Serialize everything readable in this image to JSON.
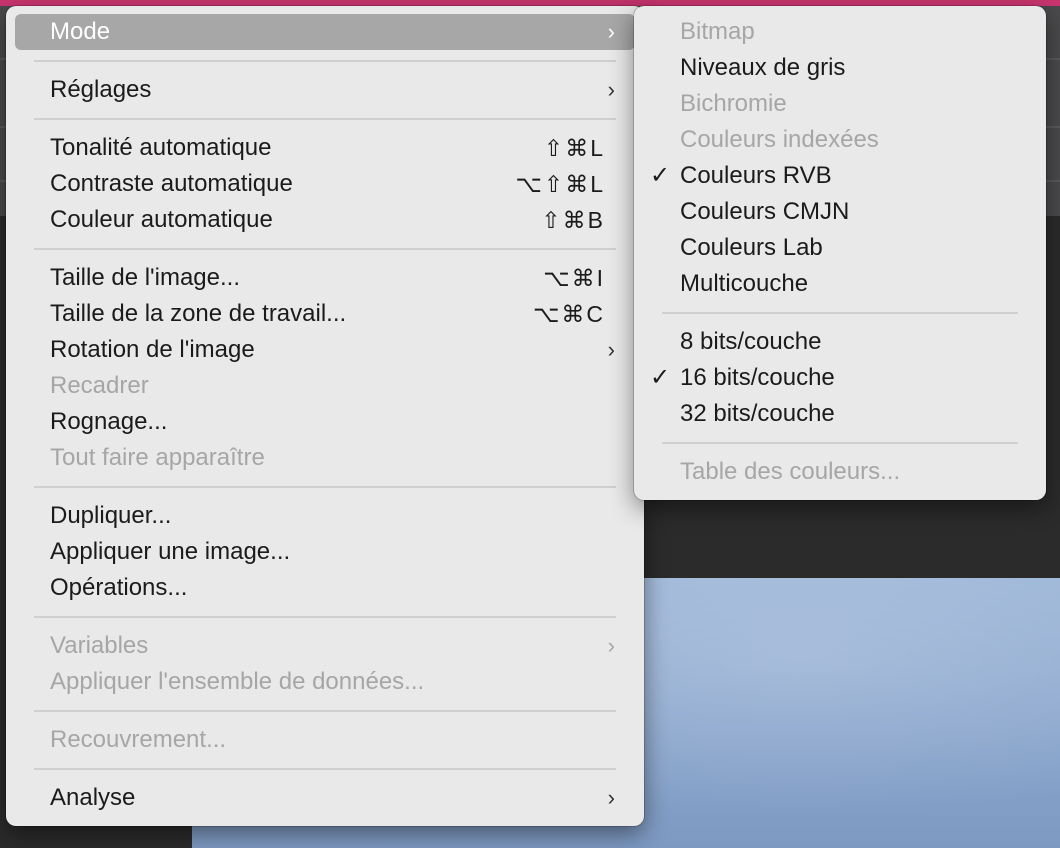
{
  "main_menu": {
    "groups": [
      [
        {
          "label": "Mode",
          "shortcut": "",
          "submenu": true,
          "disabled": false,
          "highlighted": true
        }
      ],
      [
        {
          "label": "Réglages",
          "shortcut": "",
          "submenu": true,
          "disabled": false
        }
      ],
      [
        {
          "label": "Tonalité automatique",
          "shortcut": "⇧⌘L",
          "submenu": false,
          "disabled": false
        },
        {
          "label": "Contraste automatique",
          "shortcut": "⌥⇧⌘L",
          "submenu": false,
          "disabled": false
        },
        {
          "label": "Couleur automatique",
          "shortcut": "⇧⌘B",
          "submenu": false,
          "disabled": false
        }
      ],
      [
        {
          "label": "Taille de l'image...",
          "shortcut": "⌥⌘I",
          "submenu": false,
          "disabled": false
        },
        {
          "label": "Taille de la zone de travail...",
          "shortcut": "⌥⌘C",
          "submenu": false,
          "disabled": false
        },
        {
          "label": "Rotation de l'image",
          "shortcut": "",
          "submenu": true,
          "disabled": false
        },
        {
          "label": "Recadrer",
          "shortcut": "",
          "submenu": false,
          "disabled": true
        },
        {
          "label": "Rognage...",
          "shortcut": "",
          "submenu": false,
          "disabled": false
        },
        {
          "label": "Tout faire apparaître",
          "shortcut": "",
          "submenu": false,
          "disabled": true
        }
      ],
      [
        {
          "label": "Dupliquer...",
          "shortcut": "",
          "submenu": false,
          "disabled": false
        },
        {
          "label": "Appliquer une image...",
          "shortcut": "",
          "submenu": false,
          "disabled": false
        },
        {
          "label": "Opérations...",
          "shortcut": "",
          "submenu": false,
          "disabled": false
        }
      ],
      [
        {
          "label": "Variables",
          "shortcut": "",
          "submenu": true,
          "disabled": true
        },
        {
          "label": "Appliquer l'ensemble de données...",
          "shortcut": "",
          "submenu": false,
          "disabled": true
        }
      ],
      [
        {
          "label": "Recouvrement...",
          "shortcut": "",
          "submenu": false,
          "disabled": true
        }
      ],
      [
        {
          "label": "Analyse",
          "shortcut": "",
          "submenu": true,
          "disabled": false
        }
      ]
    ]
  },
  "mode_submenu": {
    "groups": [
      [
        {
          "label": "Bitmap",
          "checked": false,
          "disabled": true
        },
        {
          "label": "Niveaux de gris",
          "checked": false,
          "disabled": false
        },
        {
          "label": "Bichromie",
          "checked": false,
          "disabled": true
        },
        {
          "label": "Couleurs indexées",
          "checked": false,
          "disabled": true
        },
        {
          "label": "Couleurs RVB",
          "checked": true,
          "disabled": false
        },
        {
          "label": "Couleurs CMJN",
          "checked": false,
          "disabled": false
        },
        {
          "label": "Couleurs Lab",
          "checked": false,
          "disabled": false
        },
        {
          "label": "Multicouche",
          "checked": false,
          "disabled": false
        }
      ],
      [
        {
          "label": "8 bits/couche",
          "checked": false,
          "disabled": false
        },
        {
          "label": "16 bits/couche",
          "checked": true,
          "disabled": false
        },
        {
          "label": "32 bits/couche",
          "checked": false,
          "disabled": false
        }
      ],
      [
        {
          "label": "Table des couleurs...",
          "checked": false,
          "disabled": true
        }
      ]
    ]
  },
  "icons": {
    "submenu_arrow": "›",
    "checkmark": "✓"
  }
}
